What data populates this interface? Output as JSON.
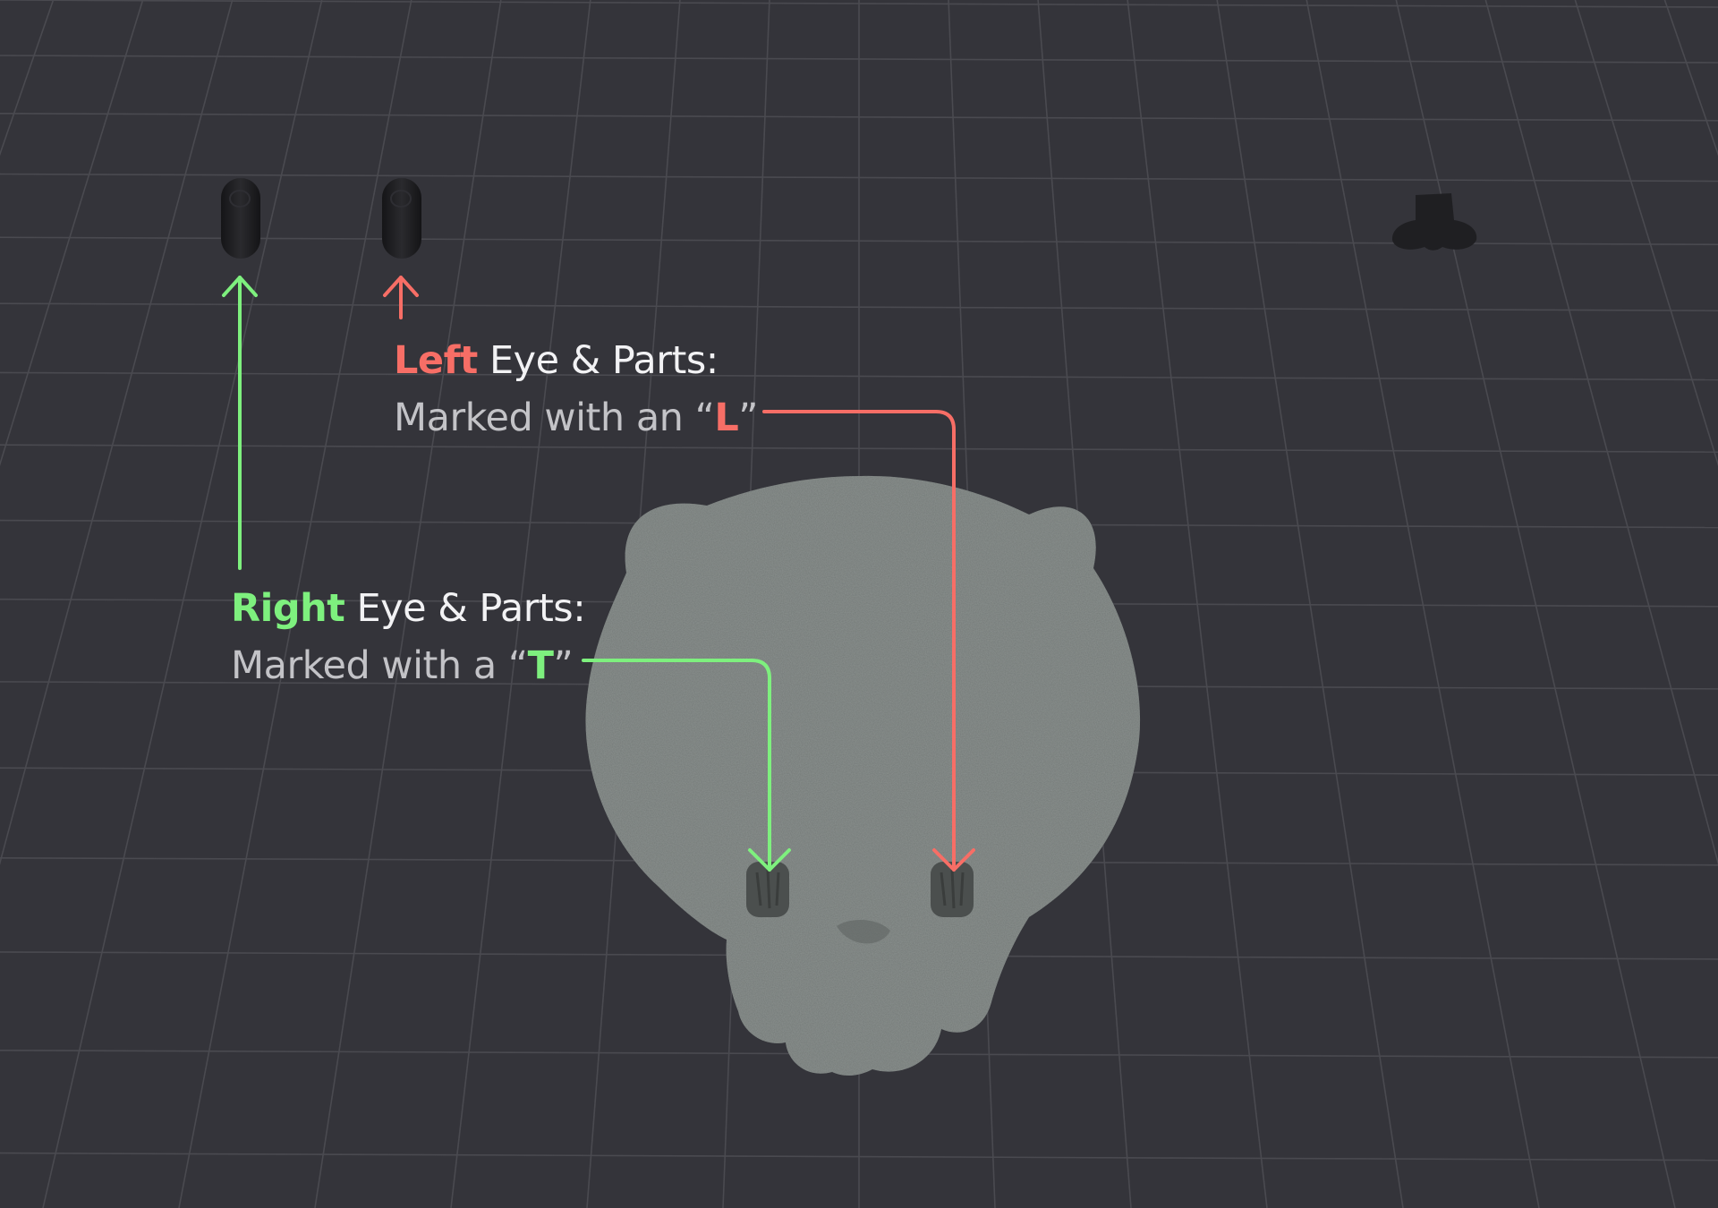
{
  "colors": {
    "background": "#34343a",
    "grid": "#4a4a50",
    "left_accent": "#f76e66",
    "right_accent": "#7ef07e",
    "model_fill": "#737977",
    "part_fill": "#1f1f22"
  },
  "annotations": {
    "left": {
      "keyword": "Left",
      "title_rest": " Eye & Parts:",
      "desc_prefix": "Marked with an “",
      "mark": "L",
      "desc_suffix": "”"
    },
    "right": {
      "keyword": "Right",
      "title_rest": " Eye & Parts:",
      "desc_prefix": "Marked with a “",
      "mark": "T",
      "desc_suffix": "”"
    }
  },
  "icons": {
    "right_eye_part": "capsule-eye-part-icon",
    "left_eye_part": "capsule-eye-part-icon",
    "nose_part": "nose-part-icon",
    "bear_head": "bear-head-model-icon"
  }
}
